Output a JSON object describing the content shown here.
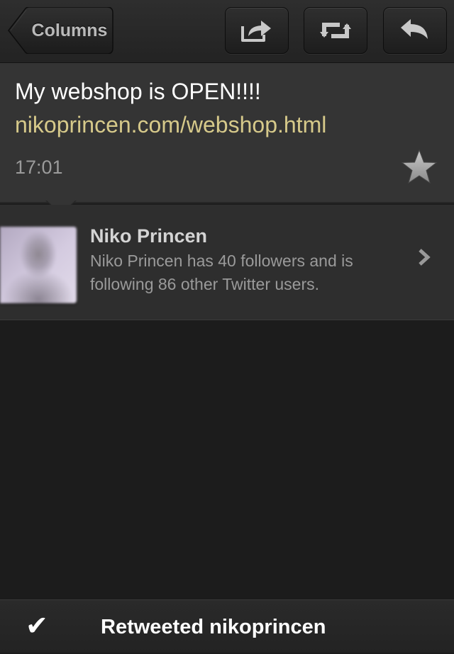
{
  "toolbar": {
    "back_label": "Columns",
    "actions": [
      {
        "name": "share",
        "icon": "share-icon"
      },
      {
        "name": "retweet",
        "icon": "retweet-icon"
      },
      {
        "name": "reply",
        "icon": "reply-icon"
      }
    ]
  },
  "tweet": {
    "text": "My webshop is OPEN!!!!",
    "link": "nikoprincen.com/webshop.html",
    "time": "17:01",
    "favorite_icon": "star-icon"
  },
  "user": {
    "name": "Niko Princen",
    "description": "Niko Princen has 40 followers and is following 86 other Twitter users.",
    "chevron_icon": "chevron-right-icon"
  },
  "status": {
    "icon": "checkmark-icon",
    "glyph": "✔",
    "message": "Retweeted nikoprincen"
  },
  "colors": {
    "link": "#d6c98a",
    "panel": "#343434",
    "background": "#1c1c1c"
  }
}
